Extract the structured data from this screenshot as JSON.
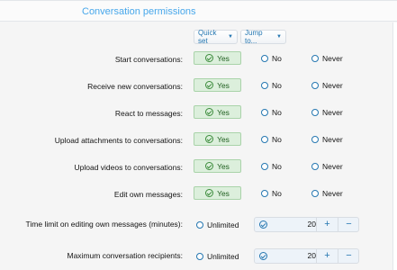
{
  "header": {
    "title": "Conversation permissions"
  },
  "toolbar": {
    "quick_set_label": "Quick set",
    "jump_to_label": "Jump to..."
  },
  "permissions": [
    {
      "label": "Start conversations:",
      "selected": "Yes",
      "options": [
        "Yes",
        "No",
        "Never"
      ]
    },
    {
      "label": "Receive new conversations:",
      "selected": "Yes",
      "options": [
        "Yes",
        "No",
        "Never"
      ]
    },
    {
      "label": "React to messages:",
      "selected": "Yes",
      "options": [
        "Yes",
        "No",
        "Never"
      ]
    },
    {
      "label": "Upload attachments to conversations:",
      "selected": "Yes",
      "options": [
        "Yes",
        "No",
        "Never"
      ]
    },
    {
      "label": "Upload videos to conversations:",
      "selected": "Yes",
      "options": [
        "Yes",
        "No",
        "Never"
      ]
    },
    {
      "label": "Edit own messages:",
      "selected": "Yes",
      "options": [
        "Yes",
        "No",
        "Never"
      ]
    }
  ],
  "numeric_settings": [
    {
      "label": "Time limit on editing own messages (minutes):",
      "unlimited_label": "Unlimited",
      "value": "20",
      "plus": "+",
      "minus": "−"
    },
    {
      "label": "Maximum conversation recipients:",
      "unlimited_label": "Unlimited",
      "value": "20",
      "plus": "+",
      "minus": "−"
    }
  ],
  "colors": {
    "accent": "#2577b1",
    "title": "#47a7eb",
    "yes_bg": "#dcefdc"
  },
  "icons": {
    "check": "check-circle-icon",
    "caret": "caret-down-icon"
  }
}
